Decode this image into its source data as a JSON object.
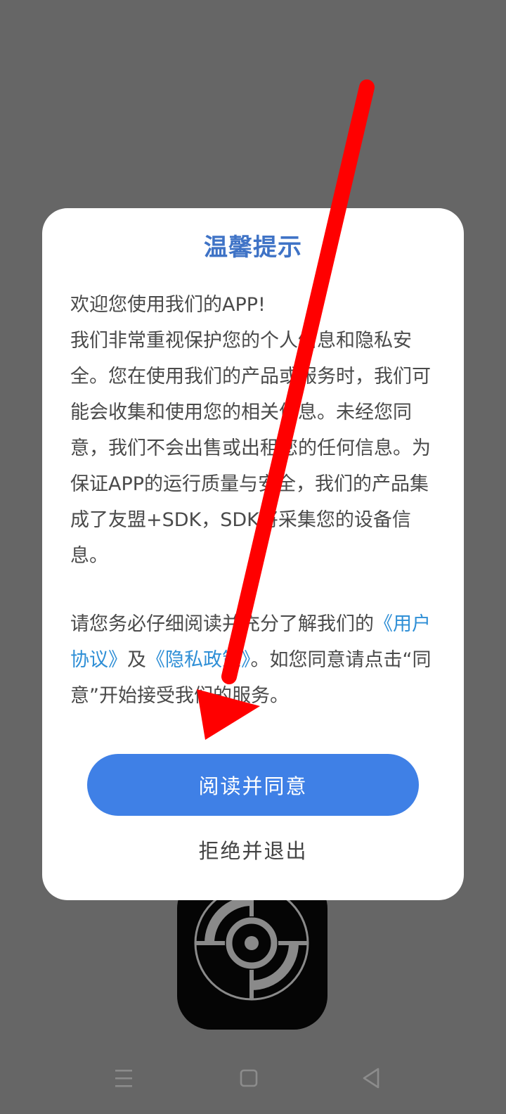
{
  "dialog": {
    "title": "温馨提示",
    "intro_line": "欢迎您使用我们的APP!",
    "body_text": "我们非常重视保护您的个人信息和隐私安全。您在使用我们的产品或服务时，我们可能会收集和使用您的相关信息。未经您同意，我们不会出售或出租您的任何信息。为保证APP的运行质量与安全，我们的产品集成了友盟+SDK，SDK将采集您的设备信息。",
    "notice_prefix": "请您务必仔细阅读并充分了解我们的",
    "user_agreement_link": "《用户协议》",
    "conjunction": "及",
    "privacy_policy_link": "《隐私政策》",
    "notice_suffix": "。如您同意请点击“同意”开始接受我们的服务。",
    "agree_button_label": "阅读并同意",
    "decline_button_label": "拒绝并退出"
  },
  "colors": {
    "background_overlay": "#666666",
    "title": "#3f73c6",
    "link": "#2f8fd6",
    "primary_button": "#3f80e6",
    "annotation_arrow": "#ff0000"
  },
  "icons": {
    "app_icon": "crosshair-target-icon",
    "nav_menu": "menu-icon",
    "nav_home": "home-square-icon",
    "nav_back": "back-triangle-icon"
  }
}
